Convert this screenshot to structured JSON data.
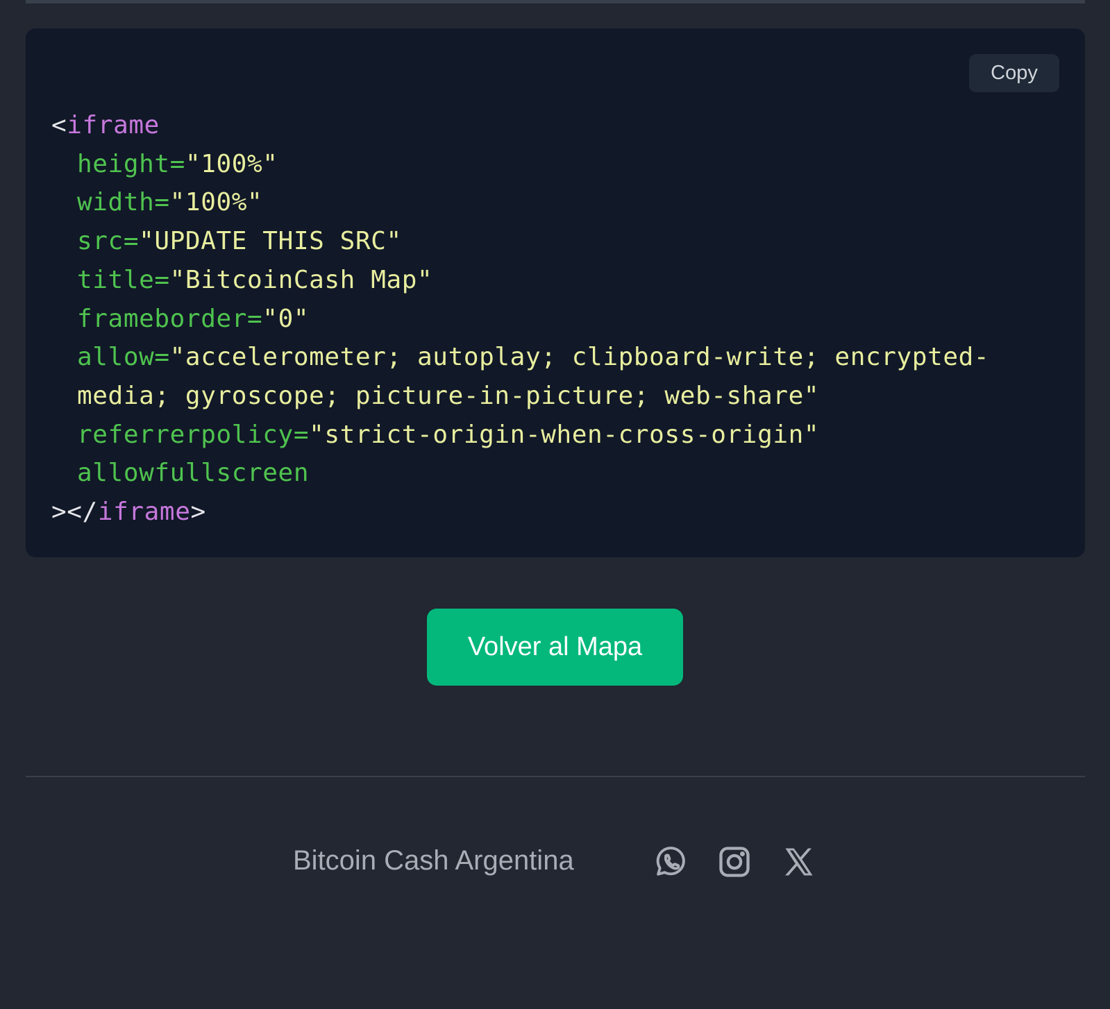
{
  "code_panel": {
    "copy_label": "Copy",
    "lines": {
      "open_lt": "<",
      "open_tag": "iframe",
      "height_attr": "height",
      "height_eq": "=",
      "height_val": "\"100%\"",
      "width_attr": "width",
      "width_eq": "=",
      "width_val": "\"100%\"",
      "src_attr": "src",
      "src_eq": "=",
      "src_val": "\"UPDATE THIS SRC\"",
      "title_attr": "title",
      "title_eq": "=",
      "title_val": "\"BitcoinCash Map\"",
      "frameborder_attr": "frameborder",
      "frameborder_eq": "=",
      "frameborder_val": "\"0\"",
      "allow_attr": "allow",
      "allow_eq": "=",
      "allow_val_1": "\"accelerometer; autoplay; clipboard-write; encrypted-",
      "allow_val_2": "media; gyroscope; picture-in-picture; web-share\"",
      "referrer_attr": "referrerpolicy",
      "referrer_eq": "=",
      "referrer_val": "\"strict-origin-when-cross-origin\"",
      "allowfullscreen_attr": "allowfullscreen",
      "close_gt_lt": "></",
      "close_tag": "iframe",
      "close_gt": ">"
    }
  },
  "back_button": {
    "label": "Volver al Mapa"
  },
  "footer": {
    "brand": "Bitcoin Cash Argentina",
    "social": [
      {
        "icon": "whatsapp-icon"
      },
      {
        "icon": "instagram-icon"
      },
      {
        "icon": "x-twitter-icon"
      }
    ]
  },
  "colors": {
    "background": "#222731",
    "code_bg": "#111827",
    "tag": "#c678dd",
    "attribute": "#4fc34f",
    "string": "#e8ee9e",
    "accent_button": "#04b87c",
    "footer_text": "#a8adb6"
  }
}
